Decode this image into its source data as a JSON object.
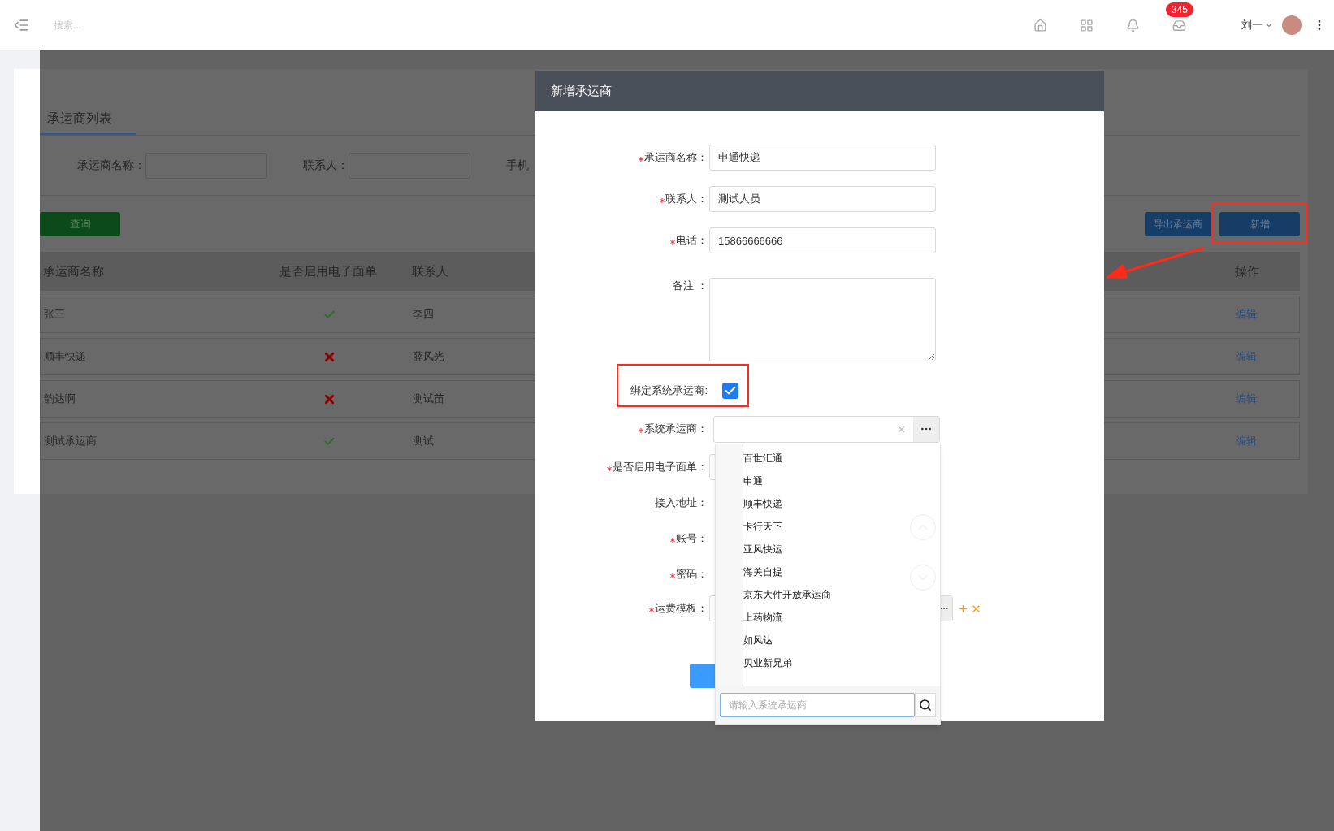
{
  "topbar": {
    "search_placeholder": "搜索...",
    "badge": "345",
    "user": "刘一"
  },
  "tab": {
    "label": "承运商列表",
    "selected": true
  },
  "filters": [
    {
      "label": "承运商名称："
    },
    {
      "label": "联系人："
    },
    {
      "label": "手机"
    }
  ],
  "buttons": {
    "query": "查询",
    "export": "导出承运商",
    "add": "新增"
  },
  "table": {
    "columns": [
      "承运商名称",
      "是否启用电子面单",
      "联系人",
      "操作"
    ],
    "rows": [
      {
        "name": "张三",
        "e_waybill": true,
        "contact": "李四",
        "action": "编辑"
      },
      {
        "name": "顺丰快递",
        "e_waybill": false,
        "contact": "薛风光",
        "action": "编辑"
      },
      {
        "name": "韵达啊",
        "e_waybill": false,
        "contact": "测试苗",
        "action": "编辑"
      },
      {
        "name": "测试承运商",
        "e_waybill": true,
        "contact": "测试",
        "action": "编辑"
      }
    ]
  },
  "dialog": {
    "title": "新增承运商",
    "fields": [
      {
        "label": "承运商名称：",
        "required": true,
        "kind": "text",
        "value": "申通快递"
      },
      {
        "label": "联系人：",
        "required": true,
        "kind": "text",
        "value": "测试人员"
      },
      {
        "label": "电话：",
        "required": true,
        "kind": "text",
        "value": "15866666666"
      },
      {
        "label": "备注 ：",
        "required": false,
        "kind": "textarea"
      },
      {
        "label": "绑定系统承运商:",
        "required": false,
        "kind": "checkbox",
        "checked": true
      },
      {
        "label": "系统承运商：",
        "required": true,
        "kind": "select"
      },
      {
        "label": "是否启用电子面单：",
        "required": true,
        "kind": "hidden"
      },
      {
        "label": "接入地址：",
        "required": false,
        "kind": "none"
      },
      {
        "label": "账号：",
        "required": true,
        "kind": "none"
      },
      {
        "label": "密码：",
        "required": true,
        "kind": "none"
      },
      {
        "label": "运费模板：",
        "required": true,
        "kind": "picker"
      }
    ]
  },
  "dropdown": {
    "options": [
      "百世汇通",
      "申通",
      "顺丰快递",
      "卡行天下",
      "亚风快运",
      "海关自提",
      "京东大件开放承运商",
      "上药物流",
      "如风达",
      "贝业新兄弟"
    ],
    "search_placeholder": "请输入系统承运商"
  }
}
